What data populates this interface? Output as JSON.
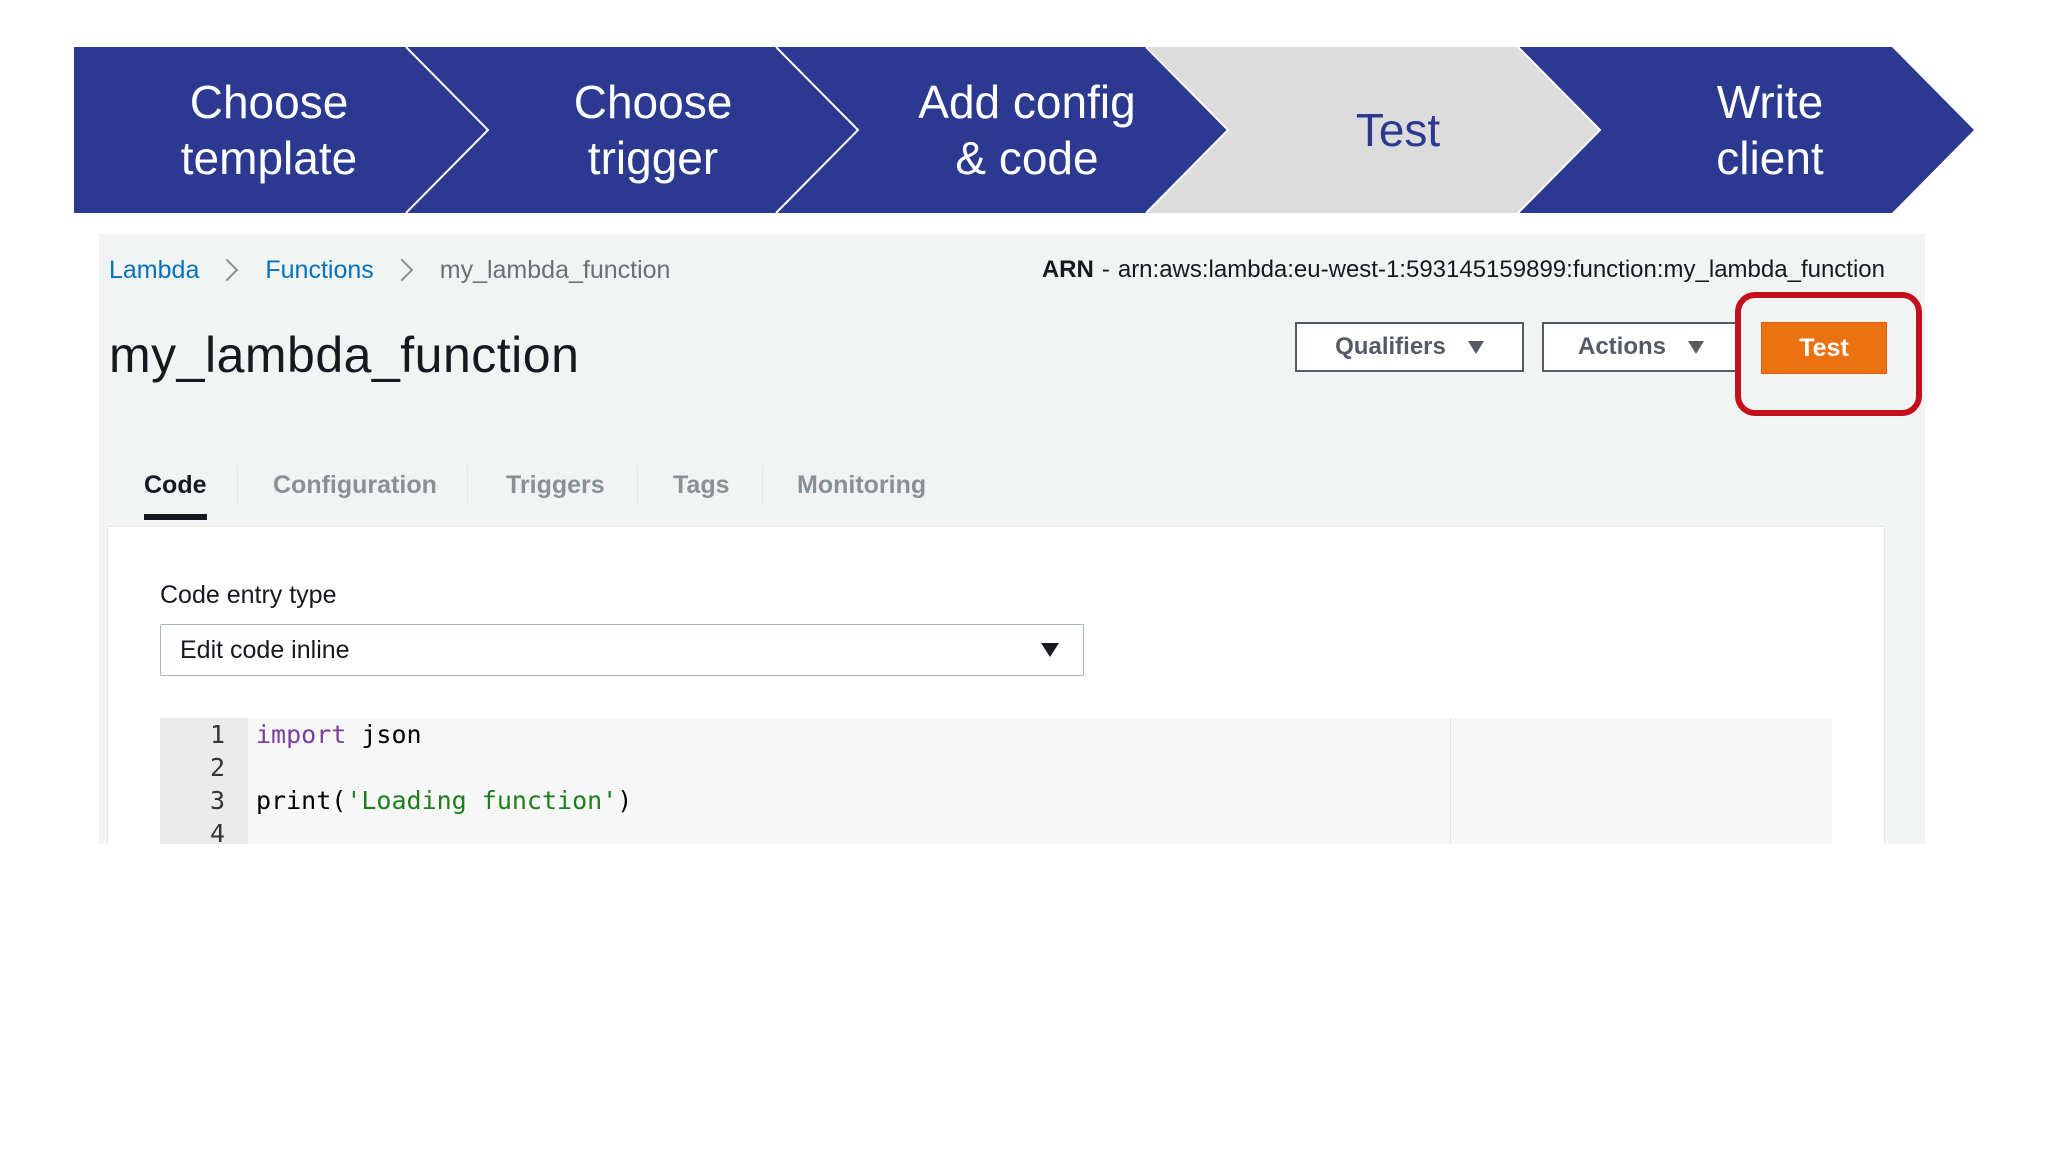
{
  "steps": [
    {
      "label": "Choose\ntemplate",
      "state": "complete"
    },
    {
      "label": "Choose\ntrigger",
      "state": "complete"
    },
    {
      "label": "Add config\n& code",
      "state": "complete"
    },
    {
      "label": "Test",
      "state": "current"
    },
    {
      "label": "Write\nclient",
      "state": "upcoming"
    }
  ],
  "colors": {
    "step_dark": "#2b3990",
    "step_light": "#dcdcdc",
    "test_button": "#ec7211",
    "highlight": "#c4101a"
  },
  "breadcrumb": {
    "lambda": "Lambda",
    "functions": "Functions",
    "current": "my_lambda_function"
  },
  "arn": {
    "key": "ARN",
    "dash": "-",
    "value": "arn:aws:lambda:eu-west-1:593145159899:function:my_lambda_function"
  },
  "function_name": "my_lambda_function",
  "buttons": {
    "qualifiers": "Qualifiers",
    "actions": "Actions",
    "test": "Test"
  },
  "tabs": {
    "code": "Code",
    "configuration": "Configuration",
    "triggers": "Triggers",
    "tags": "Tags",
    "monitoring": "Monitoring",
    "active": "Code"
  },
  "code_entry": {
    "label": "Code entry type",
    "selected": "Edit code inline"
  },
  "editor": {
    "lines": [
      {
        "num": "1",
        "keyword": "import",
        "rest": " json"
      },
      {
        "num": "2",
        "keyword": "",
        "rest": ""
      },
      {
        "num": "3",
        "fn": "print(",
        "string": "'Loading function'",
        "close": ")"
      },
      {
        "num": "4",
        "keyword": "",
        "rest": ""
      }
    ]
  }
}
